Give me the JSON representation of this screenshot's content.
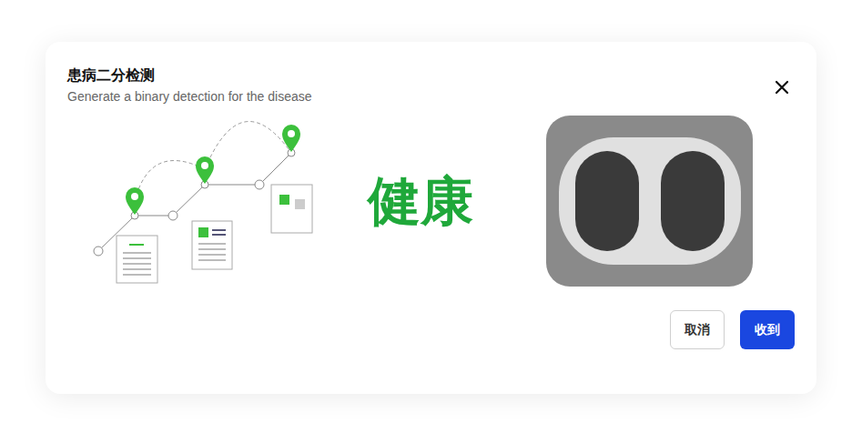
{
  "dialog": {
    "title": "患病二分检测",
    "subtitle": "Generate a binary detection for the disease"
  },
  "result": {
    "label": "健康"
  },
  "buttons": [
    {
      "label": "取消",
      "kind": "secondary"
    },
    {
      "label": "收到",
      "kind": "primary"
    }
  ]
}
